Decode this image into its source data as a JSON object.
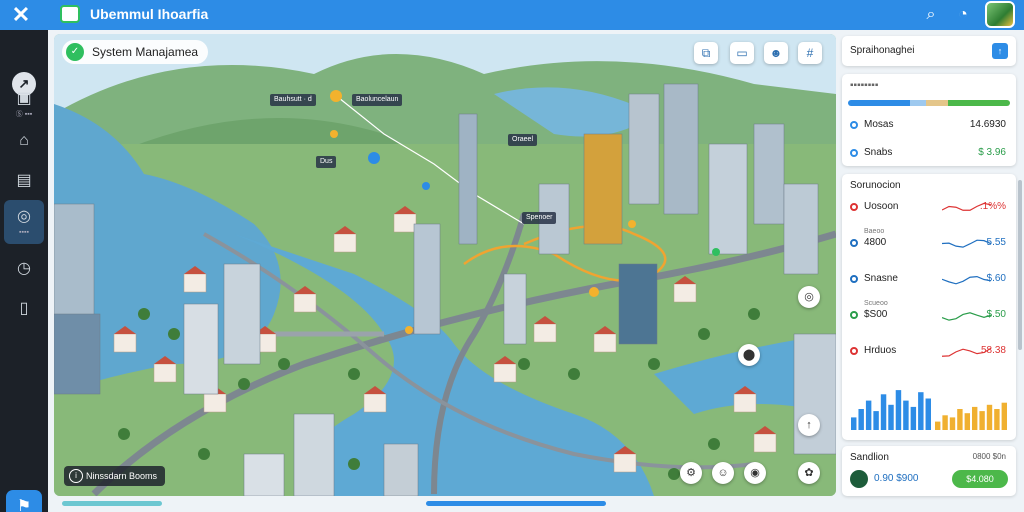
{
  "app": {
    "title": "Ubemmul Ihoarfia"
  },
  "map": {
    "header": "System Manajamea",
    "badges": [
      "Bauhsutt · d",
      "Baoluncelaun",
      "Oraeel",
      "Dus",
      "Spenoer"
    ],
    "footer": "Ninssdarn Booms"
  },
  "panel": {
    "header_title": "Spraihonaghei",
    "progress_segments": [
      {
        "fraction": 0.38,
        "color": "#2d8ce6"
      },
      {
        "fraction": 0.1,
        "color": "#9ec9ef"
      },
      {
        "fraction": 0.14,
        "color": "#e4c68a"
      },
      {
        "fraction": 0.38,
        "color": "#4cb84a"
      }
    ],
    "stats": [
      {
        "label": "Mosas",
        "value": "14.6930",
        "color": ""
      },
      {
        "label": "Snabs",
        "value": "$ 3.96",
        "color": "green"
      }
    ],
    "metrics_title": "Sorunocion",
    "metrics": [
      {
        "label": "Uosoon",
        "value": ".1%%",
        "color": "#d33"
      },
      {
        "label": "4800",
        "value": "5.55",
        "color": "#1f6fc0",
        "prefix": "Baeoo"
      },
      {
        "label": "Snasne",
        "value": "$.60",
        "color": "#1f6fc0"
      },
      {
        "label": "$S00",
        "value": "$.50",
        "color": "#2a9d4a",
        "prefix": "Scueoo"
      },
      {
        "label": "Hrduos",
        "value": "58.38",
        "color": "#d33"
      }
    ],
    "mini_chart": [
      0.3,
      0.5,
      0.7,
      0.45,
      0.85,
      0.6,
      0.95,
      0.7,
      0.55,
      0.9,
      0.75
    ],
    "mini_chart2": [
      0.2,
      0.35,
      0.3,
      0.5,
      0.4,
      0.55,
      0.45,
      0.6,
      0.5,
      0.65
    ],
    "footer_card": {
      "title": "Sandlion",
      "tag": "0800 $0n",
      "value": "0.90 $900",
      "action": "$4.080"
    }
  }
}
